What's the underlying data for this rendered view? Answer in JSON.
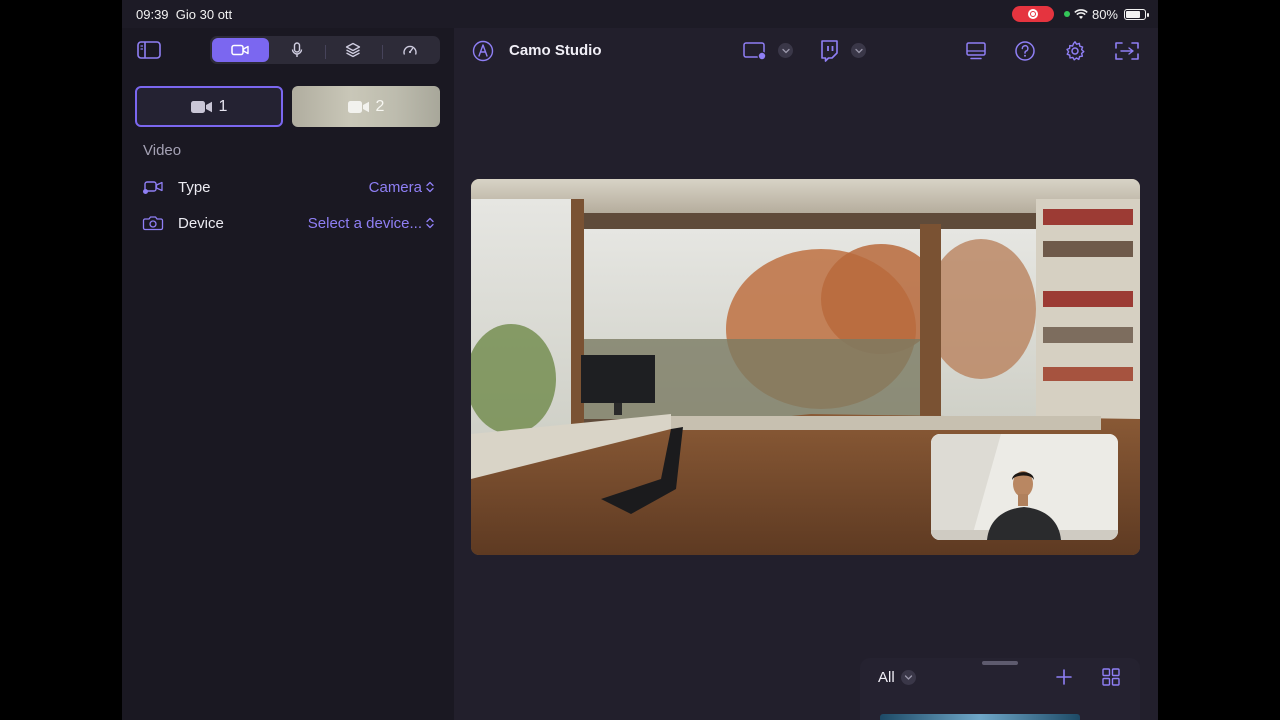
{
  "status": {
    "time": "09:39",
    "date": "Gio 30 ott",
    "battery": "80%",
    "battery_level": 0.8
  },
  "sidebar": {
    "tabs": [
      {
        "name": "video",
        "icon": "video-camera-icon",
        "active": true
      },
      {
        "name": "audio",
        "icon": "microphone-icon",
        "active": false
      },
      {
        "name": "layers",
        "icon": "layers-icon",
        "active": false
      },
      {
        "name": "performance",
        "icon": "gauge-icon",
        "active": false
      }
    ],
    "cameras": [
      {
        "label": "1",
        "selected": true
      },
      {
        "label": "2",
        "selected": false
      }
    ],
    "section_title": "Video",
    "rows": [
      {
        "label": "Type",
        "value": "Camera",
        "icon": "camera-type-icon"
      },
      {
        "label": "Device",
        "value": "Select a device...",
        "icon": "camera-icon"
      }
    ]
  },
  "main": {
    "title": "Camo Studio",
    "toolbar_icons": [
      "record-screen-icon",
      "twitch-icon",
      "display-icon",
      "help-icon",
      "settings-icon",
      "fullscreen-icon"
    ]
  },
  "bottom_panel": {
    "filter": "All"
  },
  "colors": {
    "accent": "#7b67f0",
    "accent_text": "#8f7ff5",
    "sidebar_bg": "#1a1822",
    "main_bg": "#221f2c",
    "record": "#e5343f"
  }
}
